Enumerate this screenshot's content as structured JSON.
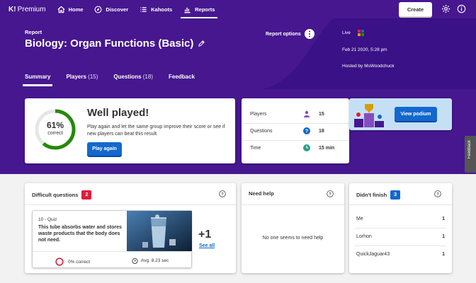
{
  "nav": {
    "brand": "K!",
    "brand_tier": "Premium",
    "items": [
      {
        "label": "Home",
        "icon": "home-icon"
      },
      {
        "label": "Discover",
        "icon": "compass-icon"
      },
      {
        "label": "Kahoots",
        "icon": "list-icon"
      },
      {
        "label": "Reports",
        "icon": "chart-icon",
        "active": true
      }
    ],
    "create_label": "Create"
  },
  "header": {
    "section_label": "Report",
    "title": "Biology: Organ Functions (Basic)",
    "report_options_label": "Report options",
    "status": "Live",
    "date": "Feb 21 2020, 5:28 pm",
    "host": "Hosted by MsWoodchuck"
  },
  "tabs": [
    {
      "label": "Summary",
      "count": "",
      "active": true
    },
    {
      "label": "Players",
      "count": "(15)"
    },
    {
      "label": "Questions",
      "count": "(18)"
    },
    {
      "label": "Feedback",
      "count": ""
    }
  ],
  "summary": {
    "percent": "61%",
    "percent_value": 0.61,
    "percent_label": "correct",
    "headline": "Well played!",
    "message": "Play again and let the same group improve their score or see if new players can beat this result.",
    "play_again_label": "Play again"
  },
  "stats": [
    {
      "label": "Players",
      "value": "15",
      "icon": "person-icon"
    },
    {
      "label": "Questions",
      "value": "18",
      "icon": "question-icon"
    },
    {
      "label": "Time",
      "value": "15 min",
      "icon": "clock-icon"
    }
  ],
  "podium": {
    "button_label": "View podium"
  },
  "feedback_tab": "Feedback",
  "difficult": {
    "title": "Difficult questions",
    "count": "2",
    "question_number": "10 - Quiz",
    "question_text": "This tube absorbs water and stores waste products that the body does not need.",
    "correct": "0% correct",
    "avg_time": "Avg. 8.23 sec",
    "more": "+1",
    "see_all": "See all"
  },
  "need_help": {
    "title": "Need help",
    "empty_message": "No one seems to need help"
  },
  "didnt_finish": {
    "title": "Didn't finish",
    "count": "3",
    "players": [
      {
        "name": "Me",
        "count": "1"
      },
      {
        "name": "Lorhon",
        "count": "1"
      },
      {
        "name": "QuickJaguar43",
        "count": "1"
      }
    ]
  },
  "colors": {
    "brand_purple": "#46178f",
    "primary_blue": "#1368ce",
    "correct_green": "#26890c",
    "danger_red": "#e21b3c"
  }
}
